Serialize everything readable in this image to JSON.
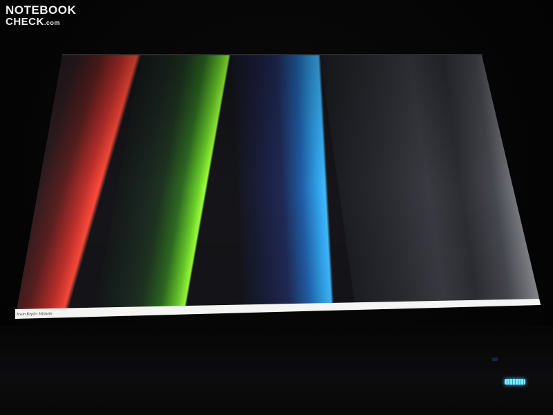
{
  "watermark": {
    "line1": "NOTEBOOK",
    "line2": "CHECK",
    "suffix": ".com"
  },
  "taskbar": {
    "text": "Irwin Kepler Winkeln"
  },
  "colors": {
    "red_band": "#ff4a3a",
    "green_band": "#9eff3a",
    "blue_band": "#3fb8ff",
    "white_band": "#ffffff",
    "led": "#7fe9ff"
  }
}
